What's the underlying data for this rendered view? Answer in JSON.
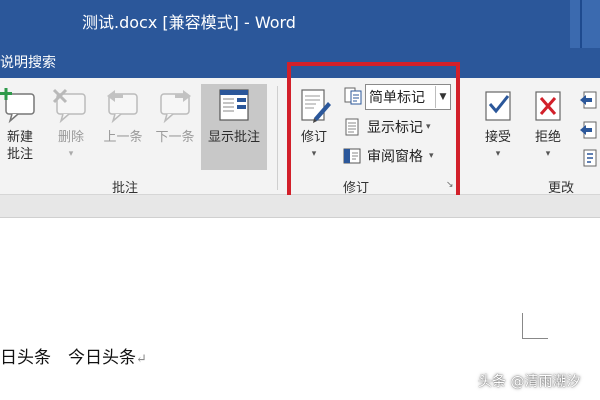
{
  "window": {
    "title": "测试.docx [兼容模式]  -  Word"
  },
  "menu": {
    "search_label": "说明搜索"
  },
  "ribbon": {
    "comments_group": {
      "label": "批注",
      "new_comment": "新建\n批注",
      "delete": "删除",
      "previous": "上一条",
      "next": "下一条",
      "show_comments": "显示批注"
    },
    "tracking_group": {
      "label": "修订",
      "track_changes": "修订",
      "markup_combo_value": "简单标记",
      "show_markup": "显示标记",
      "reviewing_pane": "审阅窗格"
    },
    "changes_group": {
      "label": "更改",
      "accept": "接受",
      "reject": "拒绝"
    }
  },
  "document": {
    "text": "日头条　今日头条",
    "para_mark": "↵"
  },
  "watermark": "头条 @清雨潮汐",
  "colors": {
    "titlebar": "#2b579a",
    "highlight": "#d2202a",
    "ribbon": "#f3f3f3"
  }
}
